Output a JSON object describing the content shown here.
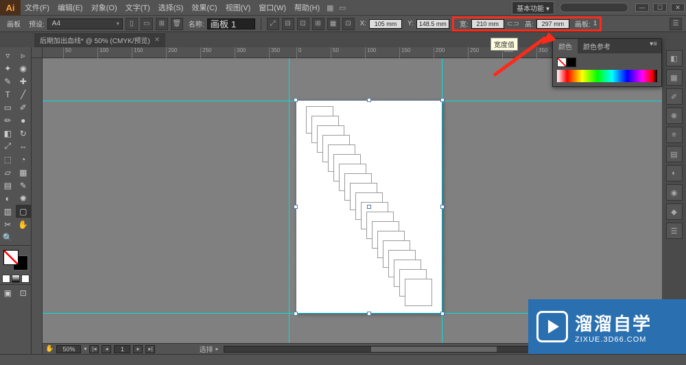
{
  "menubar": {
    "items": [
      "文件(F)",
      "编辑(E)",
      "对象(O)",
      "文字(T)",
      "选择(S)",
      "效果(C)",
      "视图(V)",
      "窗口(W)",
      "帮助(H)"
    ],
    "workspace_label": "基本功能"
  },
  "toolbar2": {
    "artboard_label": "画板",
    "preset_label": "预设:",
    "preset_value": "A4",
    "name_label": "名称:",
    "name_value": "画板 1",
    "x_label": "X:",
    "x_value": "105 mm",
    "y_label": "Y:",
    "y_value": "148.5 mm",
    "w_label": "宽:",
    "w_value": "210 mm",
    "h_label": "高:",
    "h_value": "297 mm",
    "artboard_num_label": "画板:",
    "artboard_num_value": "1"
  },
  "doc_tab": {
    "title": "后期加出血线* @ 50% (CMYK/预览)"
  },
  "ruler_ticks": [
    "50",
    "100",
    "150",
    "200",
    "250",
    "300",
    "350",
    "0",
    "50",
    "100",
    "150",
    "200",
    "250",
    "300",
    "350"
  ],
  "bottom": {
    "zoom": "50%",
    "page": "1",
    "status": "选择"
  },
  "color_panel": {
    "tab1": "颜色",
    "tab2": "颜色参考"
  },
  "tooltip_text": "宽度值",
  "watermark": {
    "big": "溜溜自学",
    "small": "ZIXUE.3D66.COM"
  }
}
